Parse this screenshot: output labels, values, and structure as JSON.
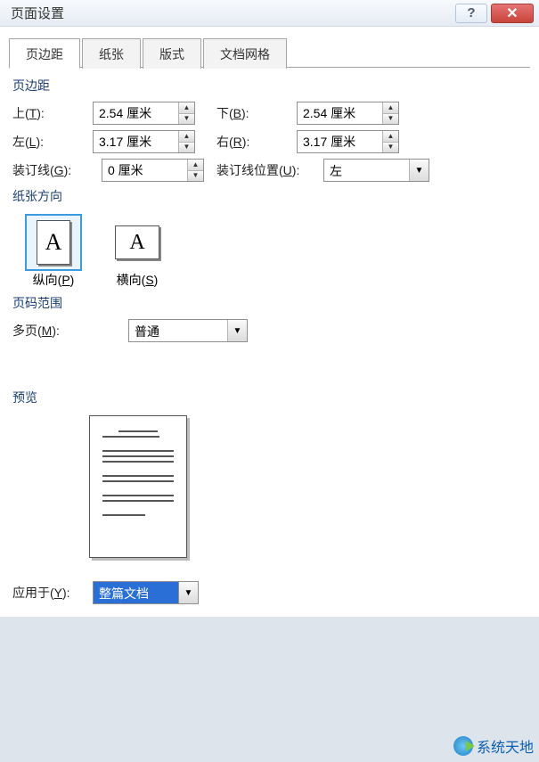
{
  "title": "页面设置",
  "titlebar": {
    "help": "?",
    "close": "✕"
  },
  "tabs": [
    {
      "label": "页边距",
      "active": true
    },
    {
      "label": "纸张",
      "active": false
    },
    {
      "label": "版式",
      "active": false
    },
    {
      "label": "文档网格",
      "active": false
    }
  ],
  "margins": {
    "group_label": "页边距",
    "top": {
      "label_pre": "上(",
      "label_key": "T",
      "label_post": "):",
      "value": "2.54 厘米"
    },
    "bottom": {
      "label_pre": "下(",
      "label_key": "B",
      "label_post": "):",
      "value": "2.54 厘米"
    },
    "left": {
      "label_pre": "左(",
      "label_key": "L",
      "label_post": "):",
      "value": "3.17 厘米"
    },
    "right": {
      "label_pre": "右(",
      "label_key": "R",
      "label_post": "):",
      "value": "3.17 厘米"
    },
    "gutter": {
      "label_pre": "装订线(",
      "label_key": "G",
      "label_post": "):",
      "value": "0 厘米"
    },
    "gutter_pos": {
      "label_pre": "装订线位置(",
      "label_key": "U",
      "label_post": "):",
      "value": "左"
    }
  },
  "orientation": {
    "group_label": "纸张方向",
    "portrait": {
      "label_pre": "纵向(",
      "label_key": "P",
      "label_post": ")",
      "glyph": "A"
    },
    "landscape": {
      "label_pre": "横向(",
      "label_key": "S",
      "label_post": ")",
      "glyph": "A"
    }
  },
  "pages": {
    "group_label": "页码范围",
    "multi": {
      "label_pre": "多页(",
      "label_key": "M",
      "label_post": "):",
      "value": "普通"
    }
  },
  "preview": {
    "group_label": "预览"
  },
  "apply": {
    "label_pre": "应用于(",
    "label_key": "Y",
    "label_post": "):",
    "value": "整篇文档"
  },
  "watermark": "系统天地",
  "glyphs": {
    "up": "▲",
    "down": "▼"
  }
}
